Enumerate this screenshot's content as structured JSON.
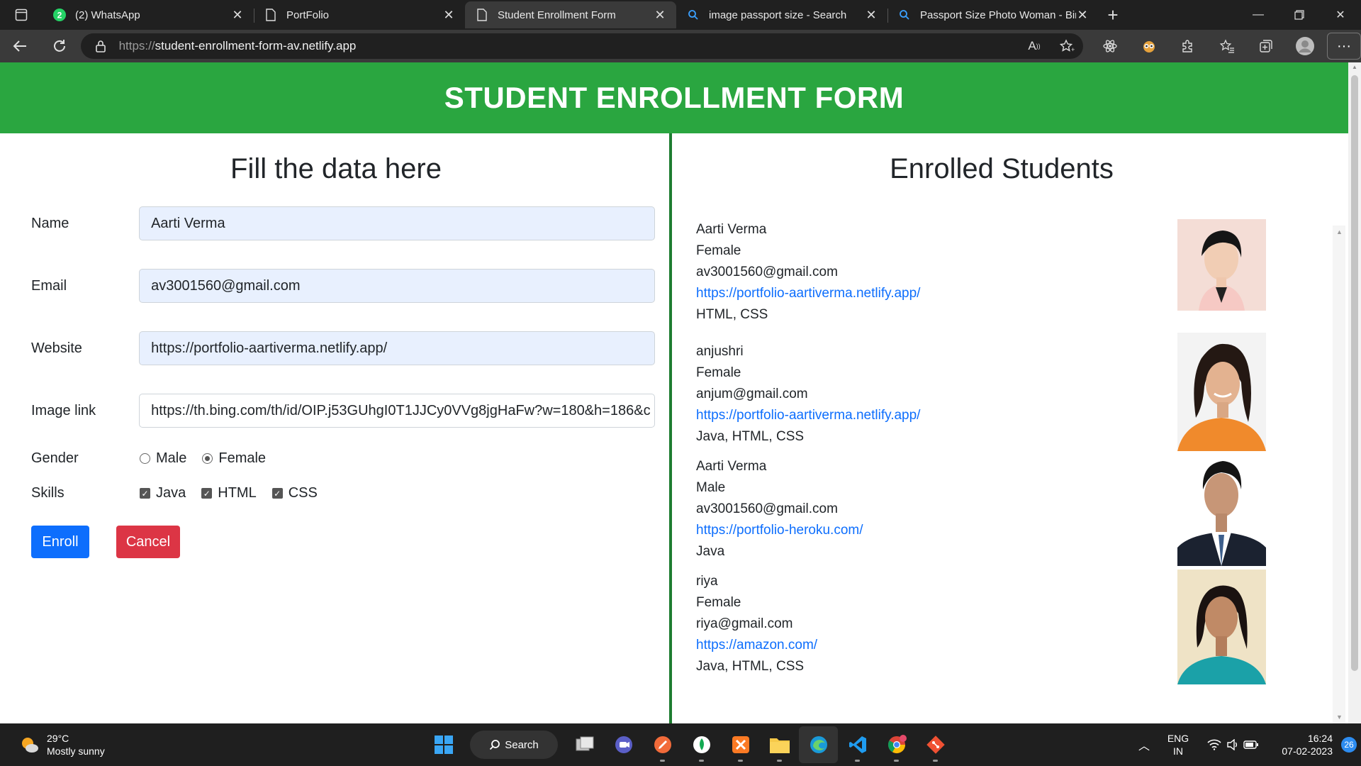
{
  "browser": {
    "tabs": [
      {
        "title": "(2) WhatsApp",
        "icon": "whatsapp-icon",
        "active": false
      },
      {
        "title": "PortFolio",
        "icon": "page-icon",
        "active": false
      },
      {
        "title": "Student Enrollment Form",
        "icon": "page-icon",
        "active": true
      },
      {
        "title": "image passport size - Search",
        "icon": "search-icon",
        "active": false
      },
      {
        "title": "Passport Size Photo Woman - Bin",
        "icon": "search-icon",
        "active": false
      }
    ],
    "whatsapp_badge": "2",
    "url_protocol": "https://",
    "url_host": "student-enrollment-form-av.netlify.app"
  },
  "page": {
    "header_title": "STUDENT ENROLLMENT FORM",
    "form": {
      "heading": "Fill the data here",
      "name_label": "Name",
      "name_value": "Aarti Verma",
      "email_label": "Email",
      "email_value": "av3001560@gmail.com",
      "website_label": "Website",
      "website_value": "https://portfolio-aartiverma.netlify.app/",
      "image_label": "Image link",
      "image_value": "https://th.bing.com/th/id/OIP.j53GUhgI0T1JJCy0VVg8jgHaFw?w=180&h=186&c",
      "gender_label": "Gender",
      "gender_options": [
        "Male",
        "Female"
      ],
      "gender_selected": "Female",
      "skills_label": "Skills",
      "skills": [
        "Java",
        "HTML",
        "CSS"
      ],
      "enroll_label": "Enroll",
      "cancel_label": "Cancel"
    },
    "enrolled": {
      "heading": "Enrolled Students",
      "students": [
        {
          "name": "Aarti Verma",
          "gender": "Female",
          "email": "av3001560@gmail.com",
          "website": "https://portfolio-aartiverma.netlify.app/",
          "skills": "HTML, CSS"
        },
        {
          "name": "anjushri",
          "gender": "Female",
          "email": "anjum@gmail.com",
          "website": "https://portfolio-aartiverma.netlify.app/",
          "skills": "Java, HTML, CSS"
        },
        {
          "name": "Aarti Verma",
          "gender": "Male",
          "email": "av3001560@gmail.com",
          "website": "https://portfolio-heroku.com/",
          "skills": "Java"
        },
        {
          "name": "riya",
          "gender": "Female",
          "email": "riya@gmail.com",
          "website": "https://amazon.com/",
          "skills": "Java, HTML, CSS"
        }
      ]
    }
  },
  "taskbar": {
    "temperature": "29°C",
    "weather": "Mostly sunny",
    "search_label": "Search",
    "lang_line1": "ENG",
    "lang_line2": "IN",
    "time": "16:24",
    "date": "07-02-2023",
    "notification_count": "26"
  },
  "colors": {
    "header_green": "#2aa640",
    "divider_green": "#1e7d31",
    "enroll_blue": "#0d6efd",
    "cancel_red": "#dc3545",
    "link_blue": "#0d6efd"
  }
}
